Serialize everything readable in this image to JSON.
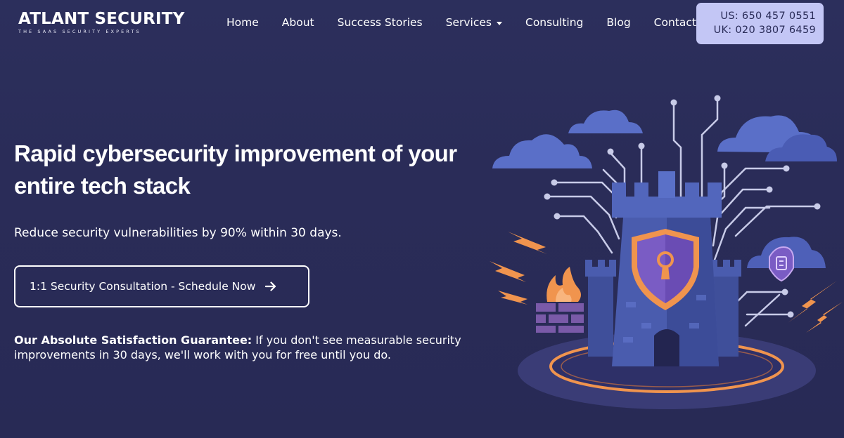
{
  "brand": {
    "name": "ATLANT SECURITY",
    "tagline": "THE SAAS SECURITY EXPERTS"
  },
  "nav": {
    "items": [
      {
        "label": "Home"
      },
      {
        "label": "About"
      },
      {
        "label": "Success Stories"
      },
      {
        "label": "Services",
        "has_dropdown": true
      },
      {
        "label": "Consulting"
      },
      {
        "label": "Blog"
      },
      {
        "label": "Contact"
      }
    ]
  },
  "phones": {
    "us": "US: 650 457 0551",
    "uk": "UK: 020 3807 6459"
  },
  "hero": {
    "title": "Rapid cybersecurity improvement of your entire tech stack",
    "subtitle": "Reduce security vulnerabilities by 90% within 30 days.",
    "cta_label": "1:1 Security Consultation - Schedule Now",
    "guarantee_label": "Our Absolute Satisfaction Guarantee:",
    "guarantee_text": " If you don't see measurable security improvements in 30 days, we'll work with you for free until you do."
  },
  "icons": {
    "cta_arrow": "arrow-right-icon",
    "services_caret": "caret-down-icon",
    "illustration": "security-castle-illustration"
  },
  "colors": {
    "background": "#2b2e5a",
    "phone_box_bg": "#c3c6f5",
    "phone_text": "#2a2c58",
    "accent_orange": "#f0944e",
    "shield_purple": "#7a5cc4",
    "cloud_blue": "#5a6fc8",
    "castle_blue": "#4a5cae"
  }
}
